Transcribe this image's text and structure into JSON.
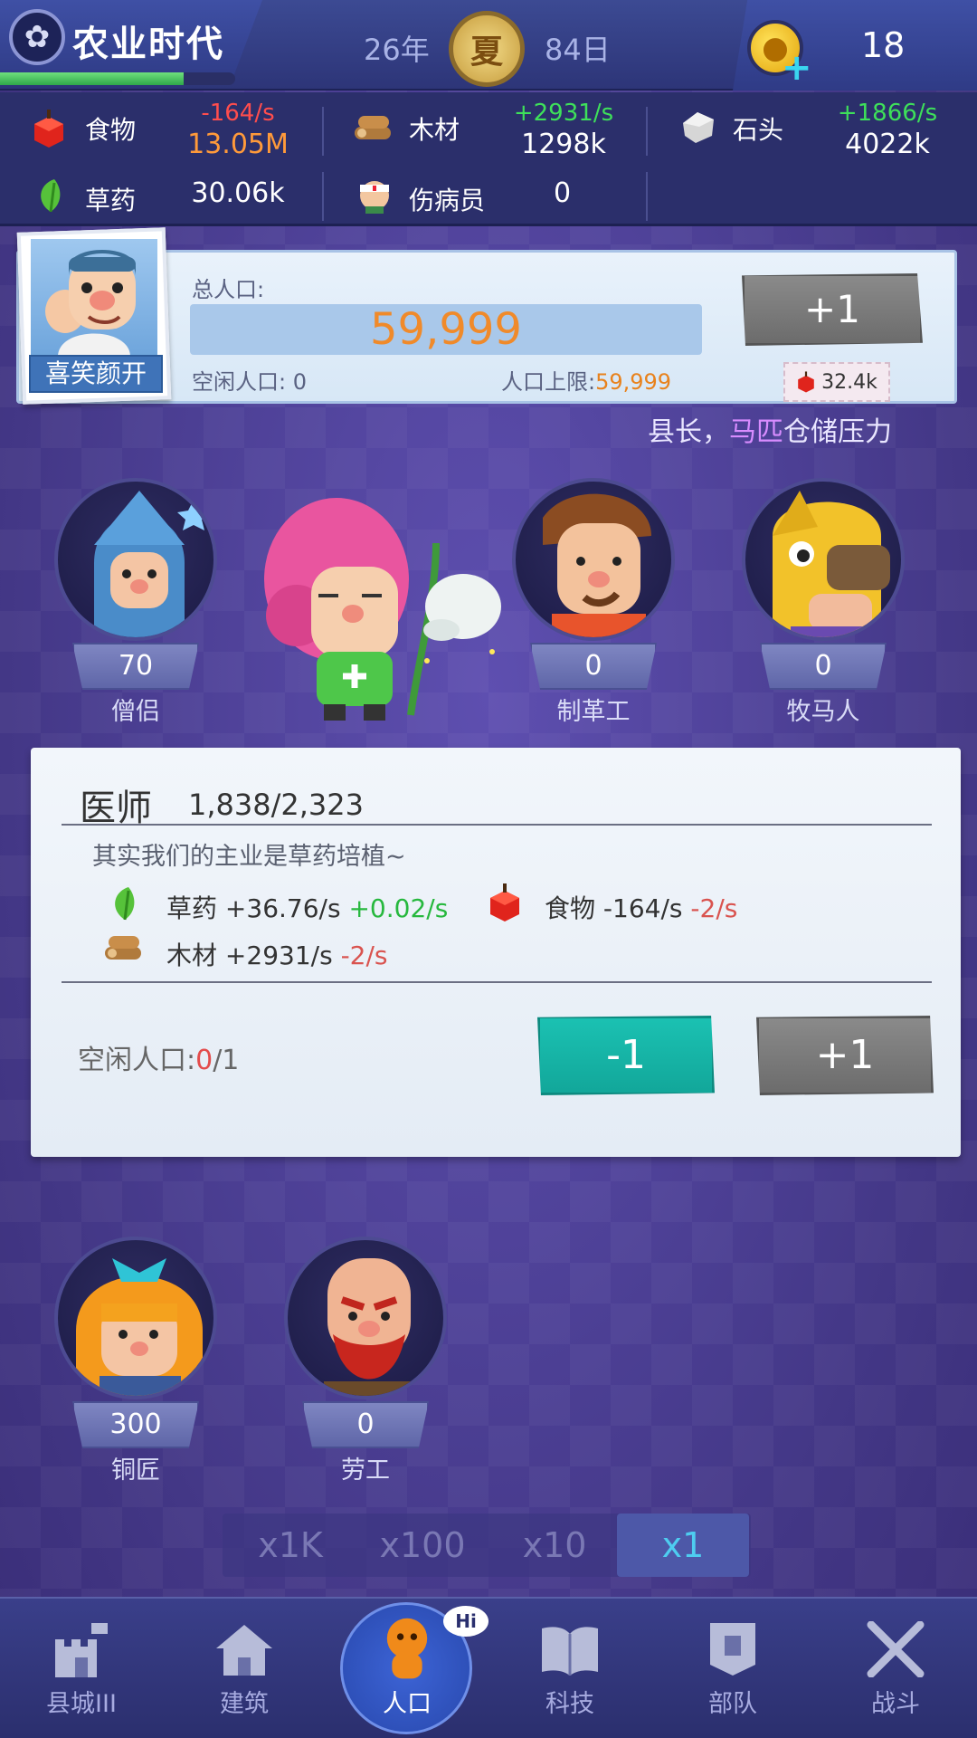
{
  "topbar": {
    "era_name": "农业时代",
    "era_progress_pct": 78,
    "year": "26年",
    "season": "夏",
    "day": "84日",
    "coins": "18"
  },
  "resources": {
    "food": {
      "label": "食物",
      "rate": "-164/s",
      "value": "13.05M"
    },
    "wood": {
      "label": "木材",
      "rate": "+2931/s",
      "value": "1298k"
    },
    "stone": {
      "label": "石头",
      "rate": "+1866/s",
      "value": "4022k"
    },
    "herb": {
      "label": "草药",
      "value": "30.06k"
    },
    "wounded": {
      "label": "伤病员",
      "value": "0"
    }
  },
  "population": {
    "mayor_mood": "喜笑颜开",
    "total_label": "总人口:",
    "total": "59,999",
    "idle_label": "空闲人口: 0",
    "cap_label": "人口上限:",
    "cap_value": "59,999",
    "add_button": "+1",
    "add_cost": "32.4k",
    "ticker_prefix": "县长，",
    "ticker_highlight": "马匹",
    "ticker_suffix": "仓储压力"
  },
  "characters": [
    {
      "name": "僧侣",
      "count": "70"
    },
    {
      "name": "制革工",
      "count": "0"
    },
    {
      "name": "牧马人",
      "count": "0"
    },
    {
      "name": "铜匠",
      "count": "300"
    },
    {
      "name": "劳工",
      "count": "0"
    }
  ],
  "detail": {
    "title": "医师",
    "progress": "1,838/2,323",
    "description": "其实我们的主业是草药培植~",
    "effects": [
      {
        "label": "草药",
        "base": "+36.76/s",
        "delta": "+0.02/s"
      },
      {
        "label": "食物",
        "base": "-164/s",
        "delta": "-2/s"
      },
      {
        "label": "木材",
        "base": "+2931/s",
        "delta": "-2/s"
      }
    ],
    "idle_label": "空闲人口:",
    "idle_current": "0",
    "idle_total": "/1",
    "minus_button": "-1",
    "plus_button": "+1"
  },
  "multipliers": [
    "x1K",
    "x100",
    "x10",
    "x1"
  ],
  "multiplier_selected": "x1",
  "nav": [
    {
      "label": "县城III",
      "icon": "castle-icon"
    },
    {
      "label": "建筑",
      "icon": "house-icon"
    },
    {
      "label": "人口",
      "icon": "citizen-icon",
      "badge": "Hi"
    },
    {
      "label": "科技",
      "icon": "book-icon"
    },
    {
      "label": "部队",
      "icon": "banner-icon"
    },
    {
      "label": "战斗",
      "icon": "crossed-swords-icon"
    }
  ],
  "colors": {
    "accent_green": "#3ee05a",
    "accent_red": "#ff4d4d",
    "pop_orange": "#f08a2a",
    "teal_button": "#1bc1b2"
  }
}
